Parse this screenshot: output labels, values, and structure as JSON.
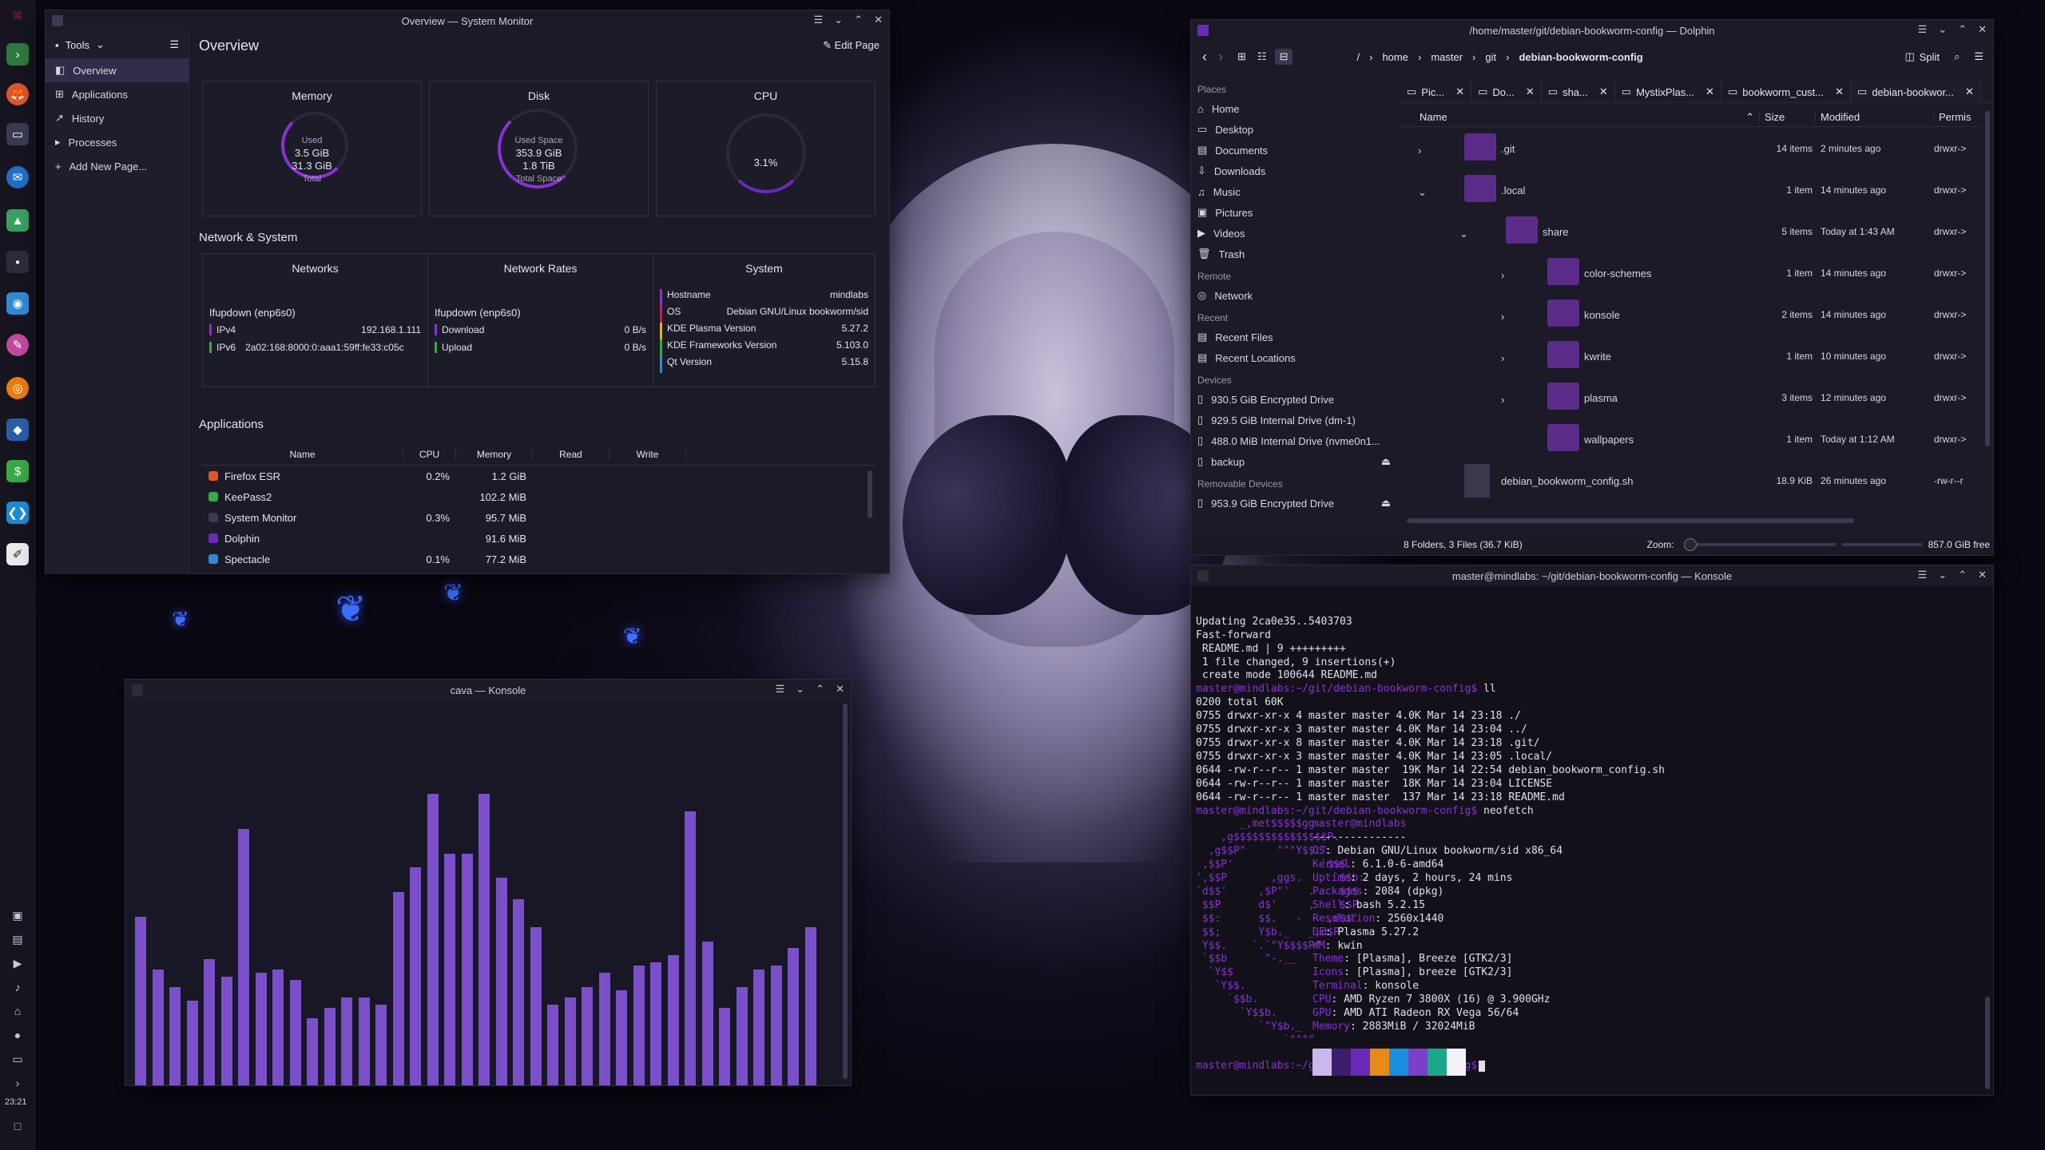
{
  "colors": {
    "accent": "#8b2fd6",
    "bar": "#7b4fc9",
    "folder": "#5b2b8a"
  },
  "panel": {
    "clock": "23:21",
    "icons": [
      "firefox-icon",
      "thunderbird-icon",
      "system-monitor-icon",
      "dolphin-icon",
      "konsole-icon",
      "spectacle-icon",
      "krita-icon",
      "blender-icon",
      "keepass-icon",
      "vscode-icon",
      "kate-icon"
    ]
  },
  "sysmon": {
    "title": "Overview — System Monitor",
    "tools": "Tools",
    "nav": [
      "Overview",
      "Applications",
      "History",
      "Processes",
      "Add New Page..."
    ],
    "page_title": "Overview",
    "edit_page": "Edit Page",
    "memory": {
      "title": "Memory",
      "used_label": "Used",
      "used": "3.5 GiB",
      "total": "31.3 GiB",
      "total_label": "Total"
    },
    "disk": {
      "title": "Disk",
      "used_label": "Used Space",
      "used": "353.9 GiB",
      "total": "1.8 TiB",
      "total_label": "Total Space"
    },
    "cpu": {
      "title": "CPU",
      "value": "3.1%"
    },
    "net_sys_title": "Network & System",
    "networks": {
      "title": "Networks",
      "iface": "Ifupdown (enp6s0)",
      "ipv4_label": "IPv4",
      "ipv4": "192.168.1.111",
      "ipv6_label": "IPv6",
      "ipv6": "2a02:168:8000:0:aaa1:59ff:fe33:c05c"
    },
    "rates": {
      "title": "Network Rates",
      "iface": "Ifupdown (enp6s0)",
      "down_label": "Download",
      "down": "0 B/s",
      "up_label": "Upload",
      "up": "0 B/s"
    },
    "system": {
      "title": "System",
      "rows": [
        [
          "Hostname",
          "mindlabs"
        ],
        [
          "OS",
          "Debian GNU/Linux bookworm/sid"
        ],
        [
          "KDE Plasma Version",
          "5.27.2"
        ],
        [
          "KDE Frameworks Version",
          "5.103.0"
        ],
        [
          "Qt Version",
          "5.15.8"
        ]
      ]
    },
    "apps_title": "Applications",
    "app_cols": [
      "Name",
      "CPU",
      "Memory",
      "Read",
      "Write"
    ],
    "apps": [
      [
        "Firefox ESR",
        "0.2%",
        "1.2 GiB"
      ],
      [
        "KeePass2",
        "",
        "102.2 MiB"
      ],
      [
        "System Monitor",
        "0.3%",
        "95.7 MiB"
      ],
      [
        "Dolphin",
        "",
        "91.6 MiB"
      ],
      [
        "Spectacle",
        "0.1%",
        "77.2 MiB"
      ]
    ]
  },
  "dolphin": {
    "title": "/home/master/git/debian-bookworm-config — Dolphin",
    "split": "Split",
    "crumbs": [
      "/",
      "home",
      "master",
      "git",
      "debian-bookworm-config"
    ],
    "tabs": [
      "Pic...",
      "Do...",
      "sha...",
      "MystixPlas...",
      "bookworm_cust...",
      "debian-bookwor..."
    ],
    "places_h": "Places",
    "places": [
      "Home",
      "Desktop",
      "Documents",
      "Downloads",
      "Music",
      "Pictures",
      "Videos",
      "Trash"
    ],
    "remote_h": "Remote",
    "remote": [
      "Network"
    ],
    "recent_h": "Recent",
    "recent": [
      "Recent Files",
      "Recent Locations"
    ],
    "devices_h": "Devices",
    "devices": [
      "930.5 GiB Encrypted Drive",
      "929.5 GiB Internal Drive (dm-1)",
      "488.0 MiB Internal Drive (nvme0n1...",
      "backup"
    ],
    "removable_h": "Removable Devices",
    "removable": [
      "953.9 GiB Encrypted Drive"
    ],
    "cols": [
      "Name",
      "Size",
      "Modified",
      "Permis"
    ],
    "rows": [
      [
        ".git",
        "14 items",
        "2 minutes ago",
        "drwxr->"
      ],
      [
        ".local",
        "1 item",
        "14 minutes ago",
        "drwxr->"
      ],
      [
        "share",
        "5 items",
        "Today at 1:43 AM",
        "drwxr->"
      ],
      [
        "color-schemes",
        "1 item",
        "14 minutes ago",
        "drwxr->"
      ],
      [
        "konsole",
        "2 items",
        "14 minutes ago",
        "drwxr->"
      ],
      [
        "kwrite",
        "1 item",
        "10 minutes ago",
        "drwxr->"
      ],
      [
        "plasma",
        "3 items",
        "12 minutes ago",
        "drwxr->"
      ],
      [
        "wallpapers",
        "1 item",
        "Today at 1:12 AM",
        "drwxr->"
      ],
      [
        "debian_bookworm_config.sh",
        "18.9 KiB",
        "26 minutes ago",
        "-rw-r--r"
      ]
    ],
    "status": "8 Folders, 3 Files (36.7 KiB)",
    "zoom": "Zoom:",
    "free": "857.0 GiB free"
  },
  "konsole": {
    "title": "master@mindlabs: ~/git/debian-bookworm-config — Konsole",
    "lines": [
      "Updating 2ca0e35..5403703",
      "Fast-forward",
      " README.md | 9 +++++++++",
      " 1 file changed, 9 insertions(+)",
      " create mode 100644 README.md"
    ],
    "prompt": "master@mindlabs:~/git/debian-bookworm-config$",
    "cmd1": " ll",
    "ls": [
      "0200 total 60K",
      "0755 drwxr-xr-x 4 master master 4.0K Mar 14 23:18 ./",
      "0755 drwxr-xr-x 3 master master 4.0K Mar 14 23:04 ../",
      "0755 drwxr-xr-x 8 master master 4.0K Mar 14 23:18 .git/",
      "0755 drwxr-xr-x 3 master master 4.0K Mar 14 23:05 .local/",
      "0644 -rw-r--r-- 1 master master  19K Mar 14 22:54 debian_bookworm_config.sh",
      "0644 -rw-r--r-- 1 master master  18K Mar 14 23:04 LICENSE",
      "0644 -rw-r--r-- 1 master master  137 Mar 14 23:18 README.md"
    ],
    "cmd2": " neofetch",
    "logo": [
      "       _,met$$$$$gg.",
      "    ,g$$$$$$$$$$$$$$$P.",
      "  ,g$$P\"     \"\"\"Y$$.\".",
      " ,$$P'              `$$$.",
      "',$$P       ,ggs.     `$$b:",
      "`d$$'     ,$P\"'   .    $$$",
      " $$P      d$'     ,    $$P",
      " $$:      $$.   -    ,d$$'",
      " $$;      Y$b._   _,d$P'",
      " Y$$.    `.`\"Y$$$$P\"'",
      " `$$b      \"-.__",
      "  `Y$$",
      "   `Y$$.",
      "     `$$b.",
      "       `Y$$b.",
      "          `\"Y$b._",
      "              `\"\"\"\""
    ],
    "user": "master@mindlabs",
    "sep": "---------------",
    "info": [
      [
        "OS",
        "Debian GNU/Linux bookworm/sid x86_64"
      ],
      [
        "Kernel",
        "6.1.0-6-amd64"
      ],
      [
        "Uptime",
        "2 days, 2 hours, 24 mins"
      ],
      [
        "Packages",
        "2084 (dpkg)"
      ],
      [
        "Shell",
        "bash 5.2.15"
      ],
      [
        "Resolution",
        "2560x1440"
      ],
      [
        "DE",
        "Plasma 5.27.2"
      ],
      [
        "WM",
        "kwin"
      ],
      [
        "Theme",
        "[Plasma], Breeze [GTK2/3]"
      ],
      [
        "Icons",
        "[Plasma], breeze [GTK2/3]"
      ],
      [
        "Terminal",
        "konsole"
      ],
      [
        "CPU",
        "AMD Ryzen 7 3800X (16) @ 3.900GHz"
      ],
      [
        "GPU",
        "AMD ATI Radeon RX Vega 56/64"
      ],
      [
        "Memory",
        "2883MiB / 32024MiB"
      ]
    ],
    "swatches": [
      "#c9b8ee",
      "#3d1d6e",
      "#6a2ab8",
      "#e68a1a",
      "#1a8fe0",
      "#7a3ec8",
      "#1aa88a",
      "#f4f2f8"
    ]
  },
  "cava": {
    "title": "cava — Konsole",
    "levels": [
      0.48,
      0.33,
      0.28,
      0.24,
      0.36,
      0.31,
      0.73,
      0.32,
      0.33,
      0.3,
      0.19,
      0.22,
      0.25,
      0.25,
      0.23,
      0.55,
      0.62,
      0.83,
      0.66,
      0.66,
      0.83,
      0.59,
      0.53,
      0.45,
      0.23,
      0.25,
      0.28,
      0.32,
      0.27,
      0.34,
      0.35,
      0.37,
      0.78,
      0.41,
      0.22,
      0.28,
      0.33,
      0.34,
      0.39,
      0.45
    ]
  }
}
